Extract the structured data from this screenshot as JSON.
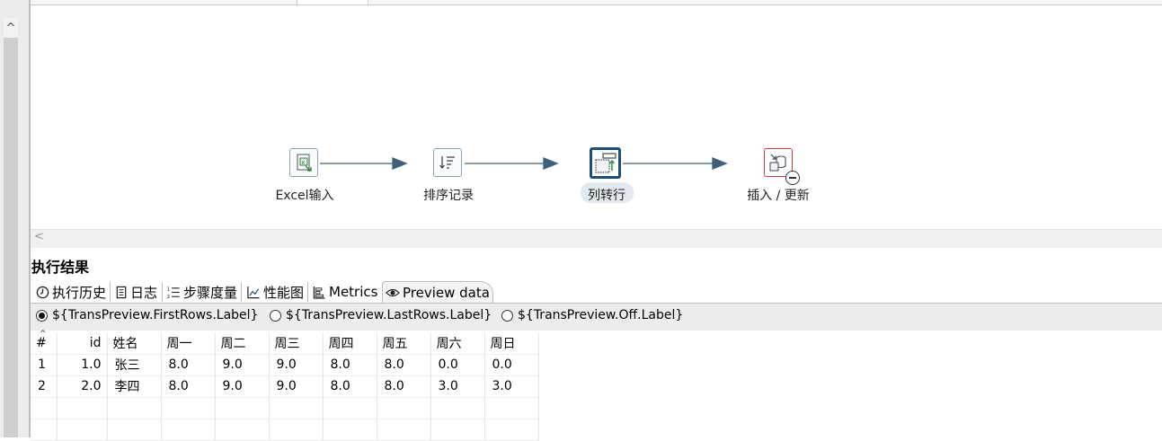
{
  "up_arrow": "^",
  "scroll_left": "<",
  "steps": [
    {
      "label": "Excel输入",
      "icon": "excel-input-icon"
    },
    {
      "label": "排序记录",
      "icon": "sort-rows-icon"
    },
    {
      "label": "列转行",
      "icon": "row-denormaliser-icon"
    },
    {
      "label": "插入 / 更新",
      "icon": "insert-update-icon"
    }
  ],
  "results": {
    "title": "执行结果",
    "tabs": [
      {
        "label": "执行历史",
        "icon": "clock-icon"
      },
      {
        "label": "日志",
        "icon": "log-icon"
      },
      {
        "label": "步骤度量",
        "icon": "list-numbered-icon"
      },
      {
        "label": "性能图",
        "icon": "line-chart-icon"
      },
      {
        "label": "Metrics",
        "icon": "metrics-icon"
      },
      {
        "label": "Preview data",
        "icon": "eye-icon"
      }
    ],
    "radios": [
      {
        "label": "${TransPreview.FirstRows.Label}",
        "selected": true
      },
      {
        "label": "${TransPreview.LastRows.Label}",
        "selected": false
      },
      {
        "label": "${TransPreview.Off.Label}",
        "selected": false
      }
    ]
  },
  "table": {
    "sort_indicator": "^",
    "headers": [
      "#",
      "id",
      "姓名",
      "周一",
      "周二",
      "周三",
      "周四",
      "周五",
      "周六",
      "周日"
    ],
    "rows": [
      [
        "1",
        "1.0",
        "张三",
        "8.0",
        "9.0",
        "9.0",
        "8.0",
        "8.0",
        "0.0",
        "0.0"
      ],
      [
        "2",
        "2.0",
        "李四",
        "8.0",
        "9.0",
        "9.0",
        "8.0",
        "8.0",
        "3.0",
        "3.0"
      ]
    ]
  },
  "colors": {
    "hop_line": "#3f5f7a",
    "selected_step_border": "#1b4f7a",
    "error_step_border": "#d23c3c",
    "selected_label_bg": "#e3e8ef"
  }
}
